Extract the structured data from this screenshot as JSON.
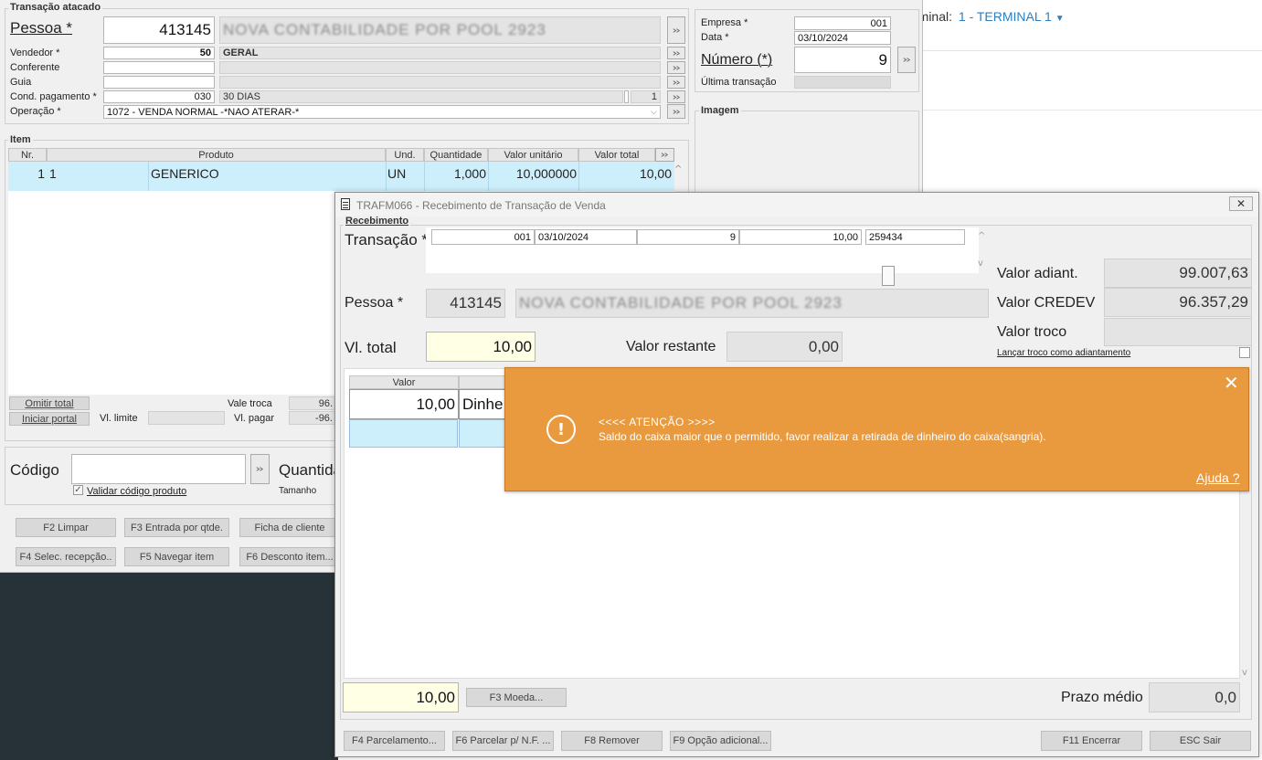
{
  "terminal": {
    "prefix": "rminal:",
    "value": "1 - TERMINAL 1"
  },
  "atacado": {
    "group_title": "Transação atacado",
    "pessoa_label": "Pessoa *",
    "pessoa_code": "413145",
    "pessoa_name": "NOVA CONTABILIDADE POR POOL 2923",
    "vendedor_label": "Vendedor *",
    "vendedor_code": "50",
    "vendedor_name": "GERAL",
    "conferente_label": "Conferente",
    "guia_label": "Guia",
    "cond_label": "Cond. pagamento *",
    "cond_code": "030",
    "cond_name": "30 DIAS",
    "cond_extra": "1",
    "operacao_label": "Operação *",
    "operacao_value": "1072 - VENDA NORMAL -*NAO ATERAR-*",
    "empresa_label": "Empresa *",
    "empresa_value": "001",
    "data_label": "Data *",
    "data_value": "03/10/2024",
    "numero_label": "Número (*)",
    "numero_value": "9",
    "ultima_label": "Última transação",
    "imagem_title": "Imagem",
    "item_title": "Item",
    "item_columns": [
      "Nr.",
      "Produto",
      "Und.",
      "Quantidade",
      "Valor unitário",
      "Valor total"
    ],
    "item_row": {
      "nr": "1",
      "code": "1",
      "produto": "GENERICO",
      "und": "UN",
      "quantidade": "1,000",
      "unitario": "10,000000",
      "total": "10,00"
    },
    "omitir_label": "Omitir total",
    "portal_label": "Iniciar portal",
    "vl_limite_label": "Vl. limite",
    "vale_troca_label": "Vale troca",
    "vale_troca_value": "96.",
    "vl_pagar_label": "Vl. pagar",
    "vl_pagar_value": "-96.",
    "codigo_label": "Código",
    "quantidade_label": "Quantida",
    "validar_label": "Validar código produto",
    "tamanho_label": "Tamanho",
    "buttons": [
      "F2 Limpar",
      "F3 Entrada por qtde.",
      "Ficha de cliente",
      "F4 Selec. recepção..",
      "F5 Navegar item",
      "F6 Desconto item..."
    ]
  },
  "receb": {
    "title": "TRAFM066 - Recebimento de Transação de Venda",
    "group_title": "Recebimento",
    "transacao_label": "Transação *",
    "trans_empresa": "001",
    "trans_data": "03/10/2024",
    "trans_numero": "9",
    "trans_valor": "10,00",
    "trans_id": "259434",
    "pessoa_label": "Pessoa *",
    "pessoa_code": "413145",
    "pessoa_name": "NOVA CONTABILIDADE POR POOL 2923",
    "vl_total_label": "Vl. total",
    "vl_total_value": "10,00",
    "valor_restante_label": "Valor restante",
    "valor_restante_value": "0,00",
    "adiant_label": "Valor adiant.",
    "adiant_value": "99.007,63",
    "credev_label": "Valor CREDEV",
    "credev_value": "96.357,29",
    "troco_label": "Valor troco",
    "troco_value": "",
    "lancar_label": "Lançar troco como adiantamento",
    "pay_col_valor": "Valor",
    "pay_row_valor": "10,00",
    "pay_row_forma": "Dinhe",
    "total_bottom": "10,00",
    "moeda_label": "F3 Moeda...",
    "prazo_label": "Prazo médio",
    "prazo_value": "0,0",
    "buttons": [
      "F4 Parcelamento...",
      "F6 Parcelar p/ N.F. ...",
      "F8 Remover",
      "F9 Opção adicional...",
      "F11 Encerrar",
      "ESC Sair"
    ]
  },
  "alert": {
    "heading": "<<<< ATENÇÃO >>>>",
    "message": "Saldo do caixa maior que o permitido, favor realizar a retirada de dinheiro do caixa(sangria).",
    "help": "Ajuda ?",
    "color": "#ea9a3e"
  },
  "colors": {
    "accent": "#2a7fc1",
    "selected_row": "#cdeefb",
    "dark_bg": "#263238"
  }
}
